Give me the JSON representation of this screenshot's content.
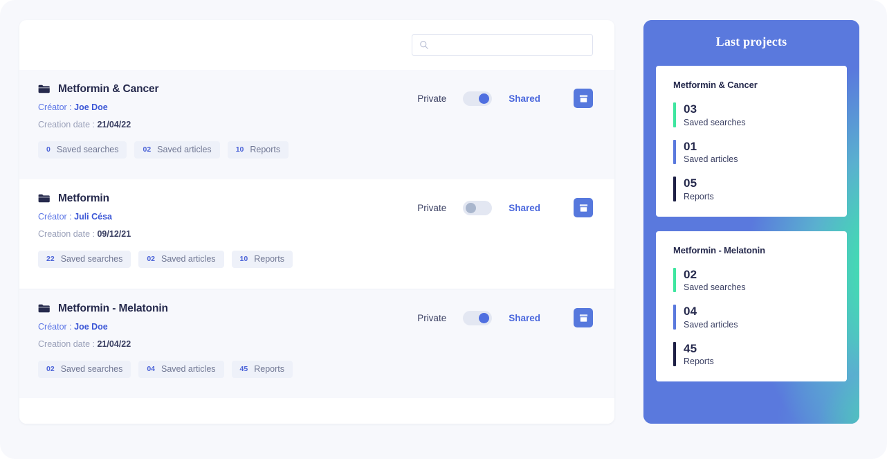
{
  "search": {
    "placeholder": "",
    "value": "",
    "icon": "search-icon"
  },
  "colors": {
    "accent_blue": "#5678dd",
    "link_blue": "#4a67dd",
    "panel_blue": "#5a79dd",
    "green": "#3fe6a0",
    "navy": "#1e2045",
    "row_alt_bg": "#f7f8fc"
  },
  "projects": [
    {
      "icon": "folder-icon",
      "title": "Metformin & Cancer",
      "creator_label": "Créator :",
      "creator_name": "Joe Doe",
      "date_label": "Creation date :",
      "date_value": "21/04/22",
      "badges": [
        {
          "count": "0",
          "label": "Saved searches"
        },
        {
          "count": "02",
          "label": "Saved articles"
        },
        {
          "count": "10",
          "label": "Reports"
        }
      ],
      "private_label": "Private",
      "shared_label": "Shared",
      "toggle_on": true,
      "archive_icon": "archive-box-icon",
      "highlighted": true
    },
    {
      "icon": "folder-icon",
      "title": "Metformin",
      "creator_label": "Créator :",
      "creator_name": "Juli Césa",
      "date_label": "Creation date :",
      "date_value": "09/12/21",
      "badges": [
        {
          "count": "22",
          "label": "Saved searches"
        },
        {
          "count": "02",
          "label": "Saved articles"
        },
        {
          "count": "10",
          "label": "Reports"
        }
      ],
      "private_label": "Private",
      "shared_label": "Shared",
      "toggle_on": false,
      "archive_icon": "archive-box-icon",
      "highlighted": false
    },
    {
      "icon": "folder-icon",
      "title": "Metformin - Melatonin",
      "creator_label": "Créator :",
      "creator_name": "Joe Doe",
      "date_label": "Creation date :",
      "date_value": "21/04/22",
      "badges": [
        {
          "count": "02",
          "label": "Saved searches"
        },
        {
          "count": "04",
          "label": "Saved articles"
        },
        {
          "count": "45",
          "label": "Reports"
        }
      ],
      "private_label": "Private",
      "shared_label": "Shared",
      "toggle_on": true,
      "archive_icon": "archive-box-icon",
      "highlighted": true
    }
  ],
  "side_panel": {
    "title": "Last projects",
    "cards": [
      {
        "title": "Metformin & Cancer",
        "stats": [
          {
            "value": "03",
            "label": "Saved searches",
            "color": "#3fe6a0"
          },
          {
            "value": "01",
            "label": "Saved articles",
            "color": "#5a79dd"
          },
          {
            "value": "05",
            "label": "Reports",
            "color": "#1e2045"
          }
        ]
      },
      {
        "title": "Metformin - Melatonin",
        "stats": [
          {
            "value": "02",
            "label": "Saved searches",
            "color": "#3fe6a0"
          },
          {
            "value": "04",
            "label": "Saved articles",
            "color": "#5a79dd"
          },
          {
            "value": "45",
            "label": "Reports",
            "color": "#1e2045"
          }
        ]
      }
    ]
  }
}
